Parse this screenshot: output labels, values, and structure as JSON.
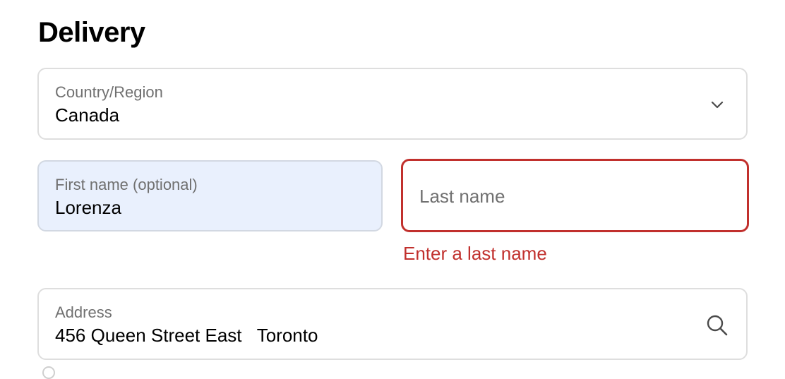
{
  "section": {
    "title": "Delivery"
  },
  "country": {
    "label": "Country/Region",
    "value": "Canada",
    "icon": "chevron-down-icon"
  },
  "first_name": {
    "label": "First name (optional)",
    "value": "Lorenza"
  },
  "last_name": {
    "placeholder": "Last name",
    "value": "",
    "error": "Enter a last name"
  },
  "address": {
    "label": "Address",
    "value": "456 Queen Street East   Toronto",
    "icon": "search-icon"
  },
  "colors": {
    "error": "#c1302d",
    "autofill_background": "#e9f0fd",
    "border": "#dedede",
    "label": "#707070"
  }
}
